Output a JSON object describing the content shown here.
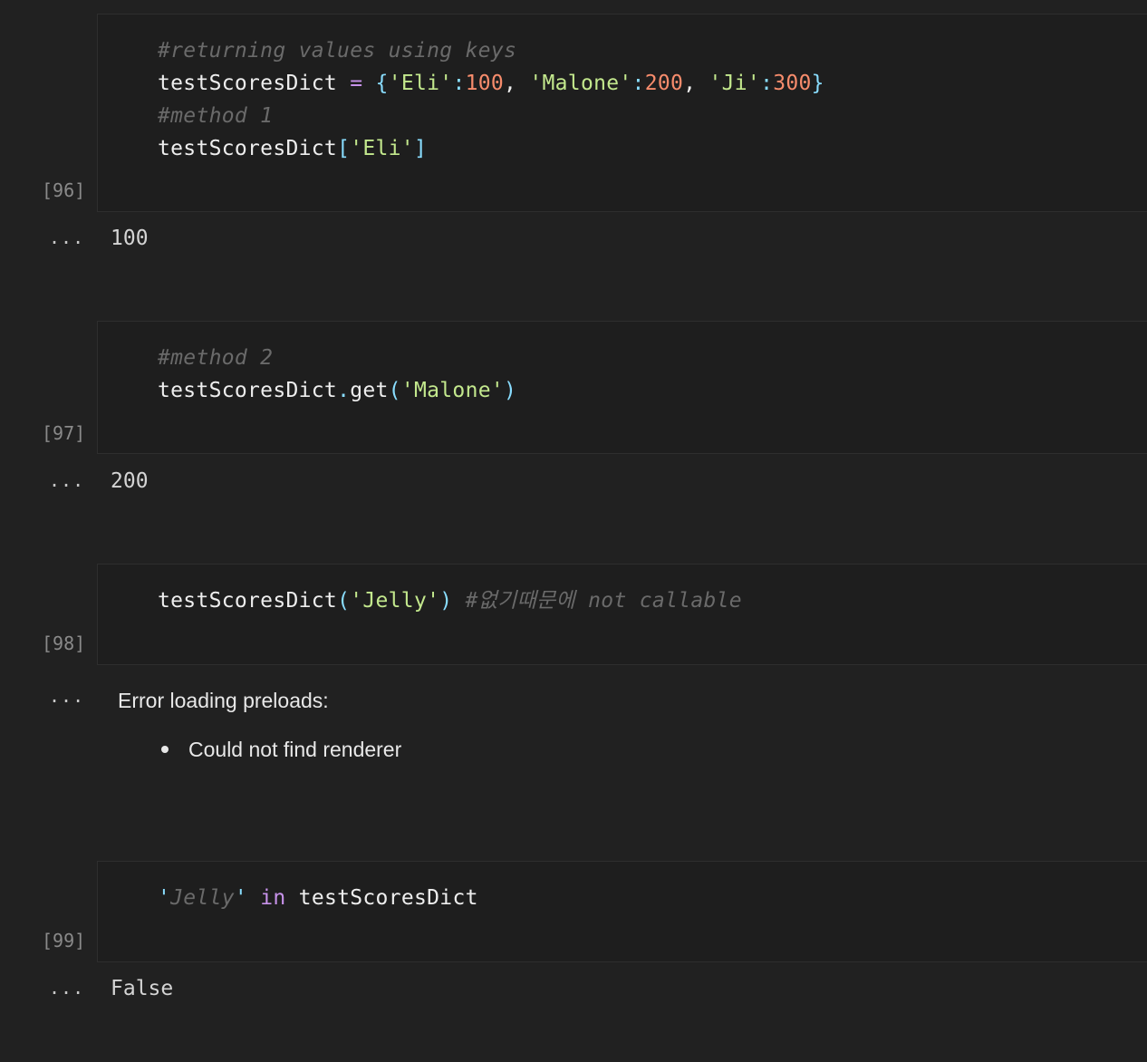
{
  "cells": [
    {
      "exec_count": "[96]",
      "lines": [
        {
          "comment": "#returning values using keys"
        },
        {
          "var": "testScoresDict",
          "op": "=",
          "open": "{",
          "k1": "'Eli'",
          "c1": ":",
          "v1": "100",
          "s1": ",",
          "k2": "'Malone'",
          "c2": ":",
          "v2": "200",
          "s2": ",",
          "k3": "'Ji'",
          "c3": ":",
          "v3": "300",
          "close": "}"
        },
        {
          "comment": "#method 1"
        },
        {
          "var": "testScoresDict",
          "open": "[",
          "key": "'Eli'",
          "close": "]"
        }
      ],
      "output_marker": "...",
      "output": "100"
    },
    {
      "exec_count": "[97]",
      "lines": [
        {
          "comment": "#method 2"
        },
        {
          "var": "testScoresDict",
          "dot": ".",
          "method": "get",
          "open": "(",
          "arg": "'Malone'",
          "close": ")"
        }
      ],
      "output_marker": "...",
      "output": "200"
    },
    {
      "exec_count": "[98]",
      "lines": [
        {
          "var": "testScoresDict",
          "open": "(",
          "arg": "'Jelly'",
          "close": ")",
          "comment": "#없기때문에 not callable"
        }
      ],
      "output_marker": "...",
      "error_title": "Error loading preloads:",
      "error_items": [
        "Could not find renderer"
      ]
    },
    {
      "exec_count": "[99]",
      "lines": [
        {
          "q1": "'",
          "str": "Jelly",
          "q2": "'",
          "kw": "in",
          "var": "testScoresDict"
        }
      ],
      "output_marker": "...",
      "output": "False"
    }
  ]
}
